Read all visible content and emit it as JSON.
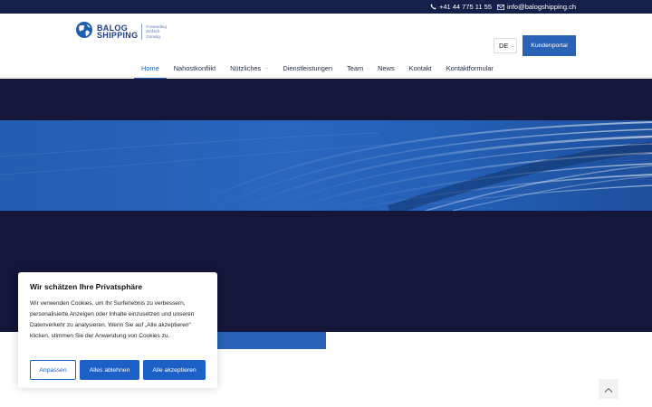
{
  "topbar": {
    "phone": "+41 44 775 11 55",
    "email": "info@balogshipping.ch",
    "phone_icon": "phone-icon",
    "email_icon": "envelope-icon"
  },
  "header": {
    "logo": {
      "line1": "BALOG",
      "line2": "SHIPPING",
      "tagline": [
        "Forwarding",
        "Einfach",
        "Günstig"
      ]
    },
    "language": "DE",
    "portal_button": "Kundenportal"
  },
  "nav": {
    "items": [
      {
        "label": "Home",
        "active": true,
        "dropdown": false
      },
      {
        "label": "Nahostkonflikt",
        "active": false,
        "dropdown": false
      },
      {
        "label": "Nützliches",
        "active": false,
        "dropdown": true
      },
      {
        "label": "Dienstleistungen",
        "active": false,
        "dropdown": false
      },
      {
        "label": "Team",
        "active": false,
        "dropdown": false
      },
      {
        "label": "News",
        "active": false,
        "dropdown": false
      },
      {
        "label": "Kontakt",
        "active": false,
        "dropdown": false
      },
      {
        "label": "Kontaktformular",
        "active": false,
        "dropdown": false
      }
    ]
  },
  "cookie_banner": {
    "title": "Wir schätzen Ihre Privatsphäre",
    "text": "Wir verwenden Cookies, um Ihr Surferlebnis zu verbessern, personalisierte Anzeigen oder Inhalte einzusetzen und unseren Datenverkehr zu analysieren. Wenn Sie auf „Alle akzeptieren“ klicken, stimmen Sie der Anwendung von Cookies zu.",
    "customize_label": "Anpassen",
    "reject_label": "Alles ablehnen",
    "accept_label": "Alle akzeptieren"
  },
  "colors": {
    "topbar": "#14204a",
    "hero_dark": "#14163a",
    "accent": "#2a62b8",
    "cookie_button": "#1c5fc7"
  },
  "icons": {
    "scroll_top": "chevron-up-icon",
    "language_dropdown": "chevron-down-icon"
  }
}
